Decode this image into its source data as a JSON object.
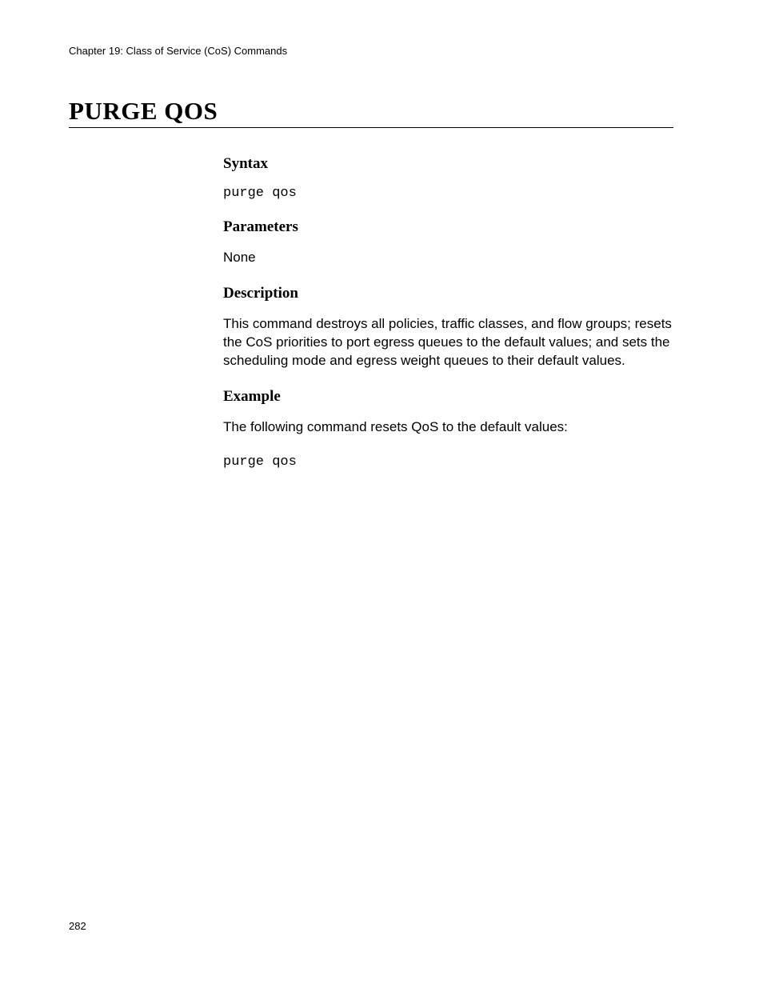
{
  "header": {
    "chapter": "Chapter 19: Class of Service (CoS) Commands"
  },
  "title": "PURGE QOS",
  "sections": {
    "syntax": {
      "heading": "Syntax",
      "code": "purge qos"
    },
    "parameters": {
      "heading": "Parameters",
      "text": "None"
    },
    "description": {
      "heading": "Description",
      "text": "This command destroys all policies, traffic classes, and flow groups; resets the CoS priorities to port egress queues to the default values; and sets the scheduling mode and egress weight queues to their default values."
    },
    "example": {
      "heading": "Example",
      "intro": "The following command resets QoS to the default values:",
      "code": "purge qos"
    }
  },
  "page_number": "282"
}
